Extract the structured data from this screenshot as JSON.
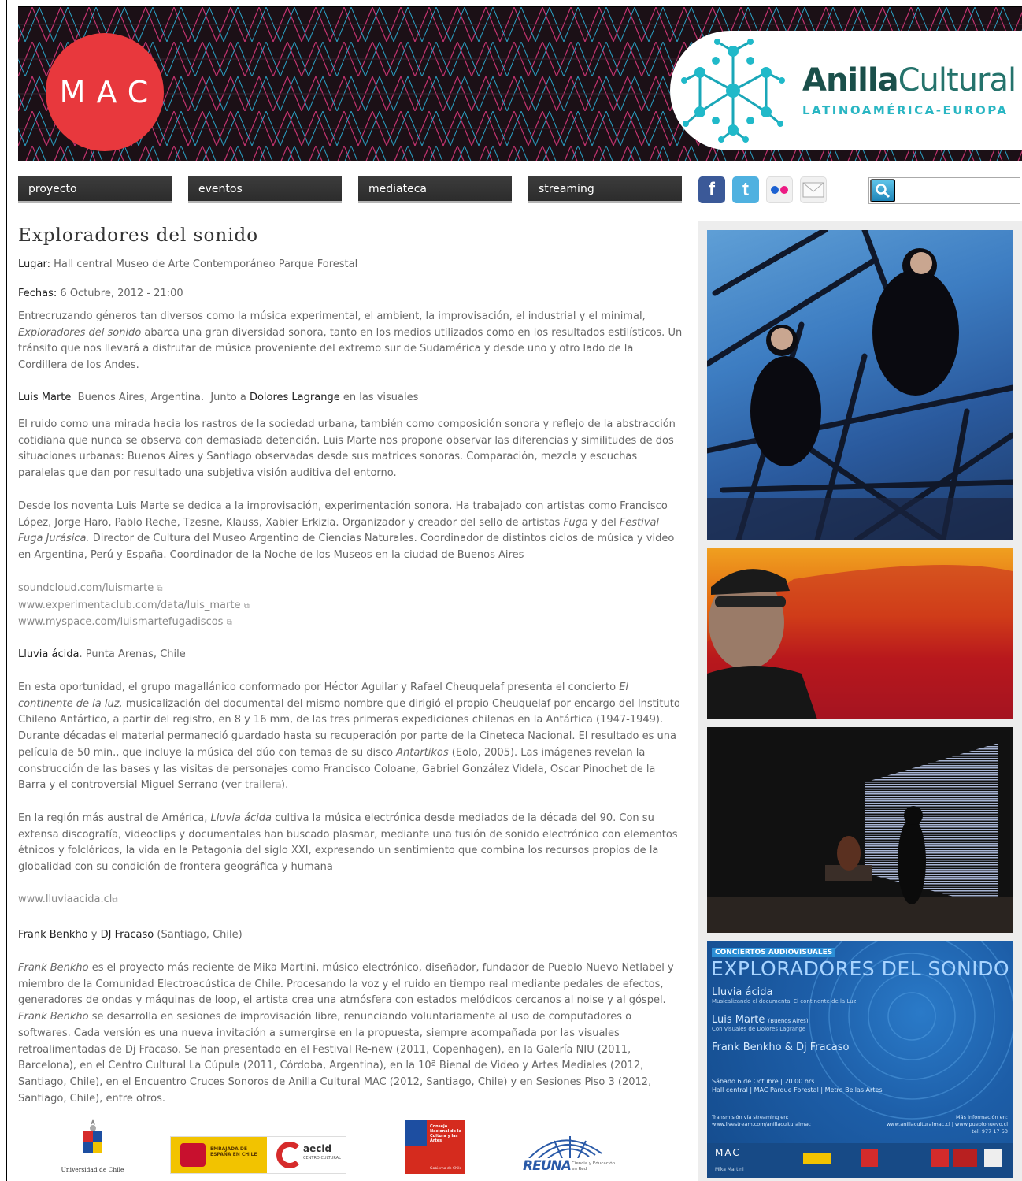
{
  "header": {
    "mac_logo": "MAC",
    "anilla_bold": "Anilla",
    "anilla_light": "Cultural",
    "anilla_sub": "LATINOAMÉRICA-EUROPA"
  },
  "nav": [
    "proyecto",
    "eventos",
    "mediateca",
    "streaming"
  ],
  "social": [
    {
      "icon": "facebook-icon",
      "glyph": "f",
      "color": "#3b5998"
    },
    {
      "icon": "twitter-icon",
      "glyph": "t",
      "color": "#4fb1e0"
    },
    {
      "icon": "flickr-icon",
      "glyph": "",
      "color": "#f4f4f4"
    },
    {
      "icon": "mail-icon",
      "glyph": "",
      "color": "#f4f4f4"
    }
  ],
  "search": {
    "placeholder": ""
  },
  "event": {
    "title": "Exploradores del sonido",
    "lugar_label": "Lugar:",
    "lugar_value": "Hall central Museo de Arte Contemporáneo  Parque Forestal",
    "fechas_label": "Fechas:",
    "fechas_value": "6 Octubre, 2012 - 21:00",
    "intro_1": "Entrecruzando géneros tan diversos como la música experimental, el ambient, la improvisación, el industrial y el minimal,",
    "intro_it": "Exploradores del sonido",
    "intro_2": " abarca una gran diversidad sonora, tanto en los medios utilizados como en los resultados estilísticos. Un tránsito que nos llevará a disfrutar de música proveniente del extremo sur de Sudamérica y desde uno y otro lado de la Cordillera de los Andes."
  },
  "luis": {
    "name": "Luis Marte",
    "place": "  Buenos Aires, Argentina.  Junto a ",
    "collab": "Dolores Lagrange",
    "collab_tail": " en las visuales",
    "para1": "El ruido como una mirada hacia los rastros de la sociedad urbana, también como composición sonora y reflejo de la abstracción cotidiana que nunca se observa con demasiada detención. Luis Marte nos propone observar las diferencias y similitudes de dos situaciones urbanas: Buenos Aires y Santiago observadas desde sus matrices sonoras. Comparación, mezcla  y escuchas paralelas que dan por resultado una subjetiva visión auditiva del entorno.",
    "para2_a": "Desde los noventa Luis Marte se dedica a la improvisación, experimentación sonora. Ha trabajado con artistas como Francisco López, Jorge Haro, Pablo Reche, Tzesne, Klauss, Xabier Erkizia. Organizador y creador del sello de artistas ",
    "para2_it1": "Fuga",
    "para2_b": " y del ",
    "para2_it2": "Festival Fuga Jurásica.",
    "para2_c": " Director de Cultura del Museo Argentino de Ciencias Naturales. Coordinador de distintos ciclos de música y video en Argentina, Perú y España. Coordinador de la Noche de los Museos en la ciudad de Buenos Aires",
    "links": [
      "soundcloud.com/luismarte",
      "www.experimentaclub.com/data/luis_marte",
      "www.myspace.com/luismartefugadiscos"
    ]
  },
  "lluvia": {
    "name": "Lluvia ácida",
    "place": ". Punta Arenas, Chile",
    "para1_a": "En esta oportunidad, el grupo magallánico conformado por Héctor Aguilar y Rafael Cheuquelaf presenta el concierto ",
    "para1_it": "El continente de la luz,",
    "para1_b": " musicalización del documental del mismo nombre que dirigió el propio Cheuquelaf por encargo del Instituto Chileno Antártico, a partir del registro, en 8 y 16 mm, de las tres primeras expediciones chilenas en la Antártica (1947-1949). Durante décadas el material permaneció guardado hasta su recuperación por parte de la Cineteca Nacional. El resultado es una película de 50 min., que incluye la música del dúo con temas de su disco ",
    "para1_it2": "Antartikos",
    "para1_c": " (Eolo, 2005). Las imágenes revelan la construcción de las bases y las visitas de personajes como Francisco Coloane, Gabriel González Videla, Oscar Pinochet de la Barra y el controversial Miguel Serrano (ver ",
    "para1_link": "trailer",
    "para1_d": ").",
    "para2_a": "En la región más austral de América, ",
    "para2_it": "Lluvia ácida",
    "para2_b": " cultiva la música electrónica desde mediados de la década del 90. Con su extensa discografía, videoclips y documentales han buscado plasmar, mediante una fusión de sonido electrónico con elementos étnicos y folclóricos, la vida en la Patagonia del siglo XXI, expresando un sentimiento que combina los recursos propios de la globalidad con su condición de frontera geográfica y humana",
    "link": "www.lluviaacida.cl"
  },
  "frank": {
    "name1": "Frank Benkho",
    "y": " y ",
    "name2": "DJ Fracaso",
    "place": " (Santiago, Chile)",
    "it1": "Frank Benkho",
    "text_a": " es el proyecto más reciente de Mika Martini, músico electrónico, diseñador,  fundador de Pueblo Nuevo Netlabel y miembro de la Comunidad Electroacústica de Chile. Procesando la voz y el ruido en tiempo real mediante pedales de efectos, generadores de ondas y máquinas de loop, el artista crea una atmósfera con  estados melódicos cercanos al noise y al góspel. ",
    "it2": "Frank Benkho",
    "text_b": " se desarrolla en sesiones de improvisación libre, renunciando voluntariamente al uso de computadores o softwares. Cada versión es una nueva invitación a sumergirse en la propuesta, siempre acompañada por las visuales retroalimentadas de Dj Fracaso. Se han presentado en el Festival Re-new (2011, Copenhagen), en la Galería NIU (2011, Barcelona), en el Centro Cultural La Cúpula (2011, Córdoba, Argentina), en la 10ª Bienal de Video y Artes Mediales (2012, Santiago, Chile), en el Encuentro Cruces Sonoros de Anilla Cultural MAC (2012, Santiago, Chile) y en Sesiones Piso 3 (2012, Santiago, Chile), entre otros."
  },
  "poster": {
    "kicker": "CONCIERTOS AUDIOVISUALES",
    "title": "EXPLORADORES DEL SONIDO",
    "a1": "Lluvia ácida",
    "a1_sub": "Musicalizando el documental El continente de la Luz",
    "a2": "Luis Marte",
    "a2_small": "(Buenos Aires)",
    "a2_sub": "Con visuales de Dolores Lagrange",
    "a3": "Frank Benkho & Dj Fracaso",
    "date": "Sábado 6 de Octubre | 20.00 hrs",
    "venue": "Hall central | MAC Parque Forestal | Metro Bellas Artes",
    "stream": "Transmisión vía streaming en:",
    "stream_url": "www.livestream.com/anillaculturalmac",
    "more": "Más información en:",
    "more_url": "www.anillaculturalmac.cl | www.pueblonuevo.cl",
    "phone": "tel: 977 17 53",
    "credit": "Mika Martini"
  },
  "footer": {
    "uchile": "Universidad de Chile",
    "embajada": "EMBAJADA DE ESPAÑA EN CHILE",
    "aecid": "aecid",
    "aecid_sub": "CENTRO CULTURAL",
    "consejo": "Consejo Nacional de la Cultura y las Artes",
    "consejo_sub": "Gobierno de Chile",
    "reuna": "REUNA",
    "reuna_sub": "Ciencia y Educación en Red"
  }
}
